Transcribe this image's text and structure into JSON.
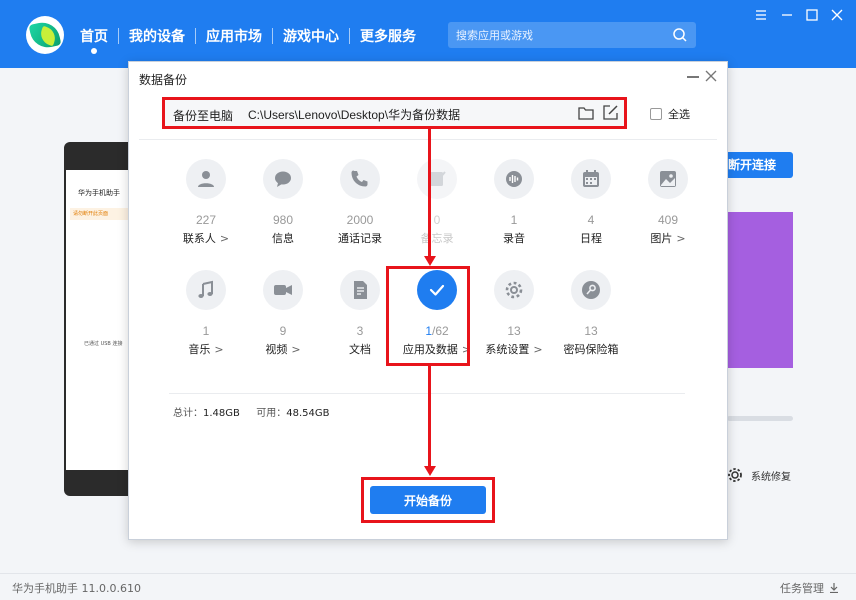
{
  "app": {
    "nav": [
      {
        "label": "首页",
        "active": true
      },
      {
        "label": "我的设备"
      },
      {
        "label": "应用市场"
      },
      {
        "label": "游戏中心"
      },
      {
        "label": "更多服务"
      }
    ],
    "search_placeholder": "搜索应用或游戏",
    "version": "华为手机助手 11.0.0.610",
    "task_manager": "任务管理"
  },
  "background": {
    "phone_title": "华为手机助手",
    "phone_warning": "请勿断开此页面",
    "phone_usb_status": "已通过 USB 连接",
    "disconnect_button": "断开连接",
    "system_repair": "系统修复"
  },
  "dialog": {
    "title": "数据备份",
    "path_label": "备份至电脑",
    "path_value": "C:\\Users\\Lenovo\\Desktop\\华为备份数据",
    "select_all_label": "全选",
    "select_all_checked": false,
    "categories": [
      {
        "name": "联系人",
        "count": "227",
        "icon": "contact-icon",
        "arrow": true,
        "state": "normal"
      },
      {
        "name": "信息",
        "count": "980",
        "icon": "message-icon",
        "arrow": false,
        "state": "normal"
      },
      {
        "name": "通话记录",
        "count": "2000",
        "icon": "phone-icon",
        "arrow": false,
        "state": "normal"
      },
      {
        "name": "备忘录",
        "count": "0",
        "icon": "memo-icon",
        "arrow": false,
        "state": "disabled"
      },
      {
        "name": "录音",
        "count": "1",
        "icon": "recording-icon",
        "arrow": false,
        "state": "normal"
      },
      {
        "name": "日程",
        "count": "4",
        "icon": "calendar-icon",
        "arrow": false,
        "state": "normal"
      },
      {
        "name": "图片",
        "count": "409",
        "icon": "picture-icon",
        "arrow": true,
        "state": "normal"
      },
      {
        "name": "音乐",
        "count": "1",
        "icon": "music-icon",
        "arrow": true,
        "state": "normal"
      },
      {
        "name": "视频",
        "count": "9",
        "icon": "video-icon",
        "arrow": true,
        "state": "normal"
      },
      {
        "name": "文档",
        "count": "3",
        "icon": "document-icon",
        "arrow": false,
        "state": "normal"
      },
      {
        "name": "应用及数据",
        "count_selected": "1",
        "count_total": "/62",
        "icon": "check-icon",
        "arrow": true,
        "state": "selected"
      },
      {
        "name": "系统设置",
        "count": "13",
        "icon": "settings-icon",
        "arrow": true,
        "state": "normal"
      },
      {
        "name": "密码保险箱",
        "count": "13",
        "icon": "password-vault-icon",
        "arrow": false,
        "state": "normal"
      }
    ],
    "total_label": "总计：",
    "total_value": "1.48GB",
    "available_label": "可用：",
    "available_value": "48.54GB",
    "start_button": "开始备份",
    "accent_color": "#1f7df0",
    "highlight_color": "#e8141b"
  }
}
